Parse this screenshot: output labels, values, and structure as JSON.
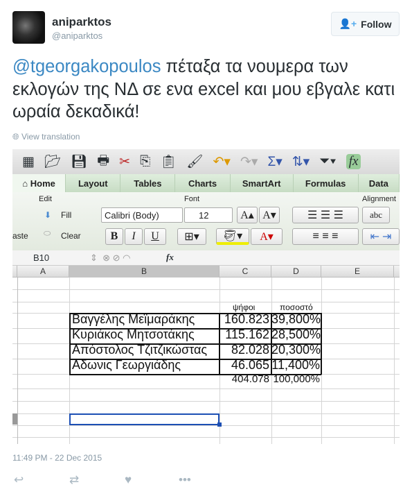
{
  "user": {
    "name": "aniparktos",
    "handle": "@aniparktos",
    "follow_label": "Follow"
  },
  "tweet": {
    "mention": "@tgeorgakopoulos",
    "text": " πέταξα τα νουμερα των εκλογών της ΝΔ σε ενα excel και μου εβγαλε κατι ωραία δεκαδικά!",
    "view_translation": "View translation",
    "timestamp": "11:49 PM - 22 Dec 2015"
  },
  "excel": {
    "tabs": [
      "Home",
      "Layout",
      "Tables",
      "Charts",
      "SmartArt",
      "Formulas",
      "Data"
    ],
    "groups": {
      "edit": "Edit",
      "font": "Font",
      "alignment": "Alignment"
    },
    "fill": "Fill",
    "clear": "Clear",
    "paste": "aste",
    "font_name": "Calibri (Body)",
    "font_size": "12",
    "bold": "B",
    "italic": "I",
    "underline": "U",
    "wrap": "abc",
    "cell_ref": "B10",
    "fx": "fx",
    "columns": [
      "A",
      "B",
      "C",
      "D",
      "E"
    ],
    "headers": {
      "votes": "ψήφοι",
      "percent": "ποσοστό"
    },
    "rows": [
      {
        "name": "Βαγγέλης Μεϊμαράκης",
        "votes": "160.823",
        "percent": "39,800%"
      },
      {
        "name": "Κυριάκος Μητσοτάκης",
        "votes": "115.162",
        "percent": "28,500%"
      },
      {
        "name": "Απόστολος Τζιτζικώστας",
        "votes": "82.028",
        "percent": "20,300%"
      },
      {
        "name": "Αδωνις Γεωργιάδης",
        "votes": "46.065",
        "percent": "11,400%"
      }
    ],
    "total": {
      "votes": "404.078",
      "percent": "100,000%"
    }
  }
}
